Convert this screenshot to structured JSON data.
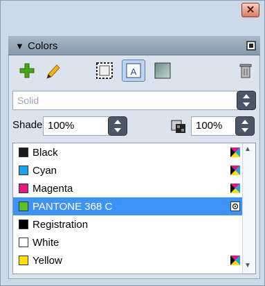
{
  "window": {
    "close_label": "✕"
  },
  "panel": {
    "title": "Colors"
  },
  "type_dropdown": {
    "value": "Solid"
  },
  "shade": {
    "label": "Shade:",
    "value": "100%"
  },
  "tint": {
    "value": "100%"
  },
  "swatches": [
    {
      "name": "Black",
      "color": "#1a1a1a",
      "icon": "cmyk-process-icon"
    },
    {
      "name": "Cyan",
      "color": "#1aa3e6",
      "icon": "cmyk-process-icon"
    },
    {
      "name": "Magenta",
      "color": "#e0197e",
      "icon": "cmyk-process-icon"
    },
    {
      "name": "PANTONE 368 C",
      "color": "#5bbf2a",
      "icon": "spot-color-icon",
      "selected": true
    },
    {
      "name": "Registration",
      "color": "#000000",
      "icon": ""
    },
    {
      "name": "White",
      "color": "#ffffff",
      "icon": ""
    },
    {
      "name": "Yellow",
      "color": "#ffe100",
      "icon": "cmyk-process-icon"
    }
  ],
  "colors": {
    "selection": "#3d94f6",
    "panel": "#dbe4ee",
    "add": "#4aa21a"
  }
}
